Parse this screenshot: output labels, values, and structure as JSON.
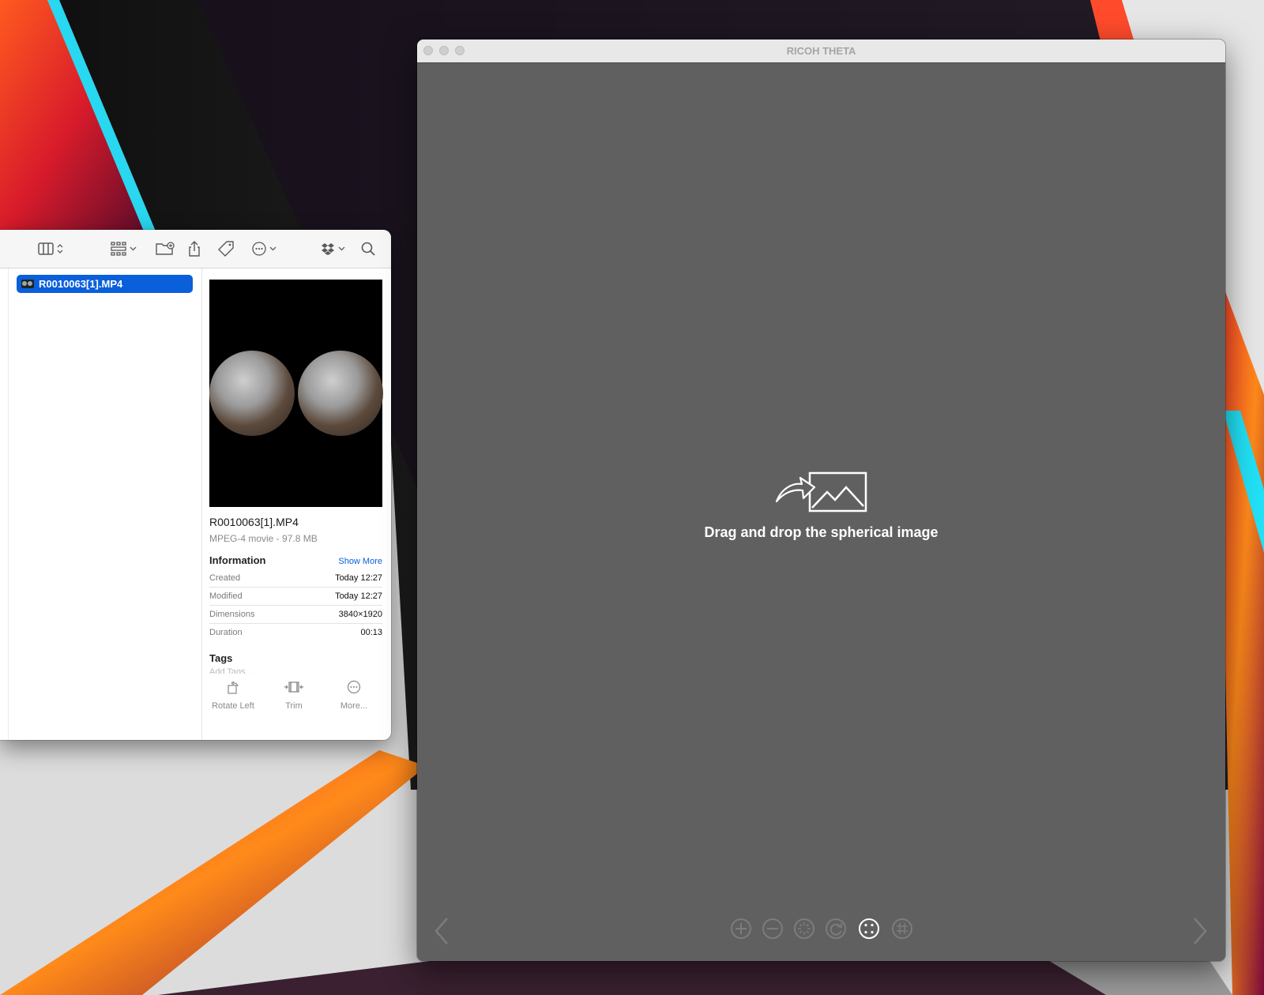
{
  "finder": {
    "toolbar": {
      "icons": [
        "column-view-icon",
        "group-icon",
        "new-folder-icon",
        "share-icon",
        "tag-icon",
        "more-icon",
        "dropbox-icon",
        "search-icon"
      ]
    },
    "file_list": [
      {
        "name": "R0010063[1].MP4",
        "selected": true
      }
    ],
    "preview": {
      "file_name": "R0010063[1].MP4",
      "file_type": "MPEG-4 movie - 97.8 MB",
      "information_title": "Information",
      "show_more": "Show More",
      "metadata": [
        {
          "key": "Created",
          "value": "Today 12:27"
        },
        {
          "key": "Modified",
          "value": "Today 12:27"
        },
        {
          "key": "Dimensions",
          "value": "3840×1920"
        },
        {
          "key": "Duration",
          "value": "00:13"
        }
      ],
      "tags_title": "Tags",
      "add_tags_placeholder": "Add Tags..."
    },
    "quick_actions": [
      {
        "label": "Rotate Left",
        "icon": "rotate-left-icon"
      },
      {
        "label": "Trim",
        "icon": "trim-icon"
      },
      {
        "label": "More...",
        "icon": "more-icon"
      }
    ]
  },
  "theta": {
    "title": "RICOH THETA",
    "drop_message": "Drag and drop the spherical image",
    "controls": [
      "zoom-in-icon",
      "zoom-out-icon",
      "auto-rotate-icon",
      "rotate-icon",
      "fit-view-icon",
      "flat-view-icon"
    ],
    "accent": "#0a5fdb"
  }
}
